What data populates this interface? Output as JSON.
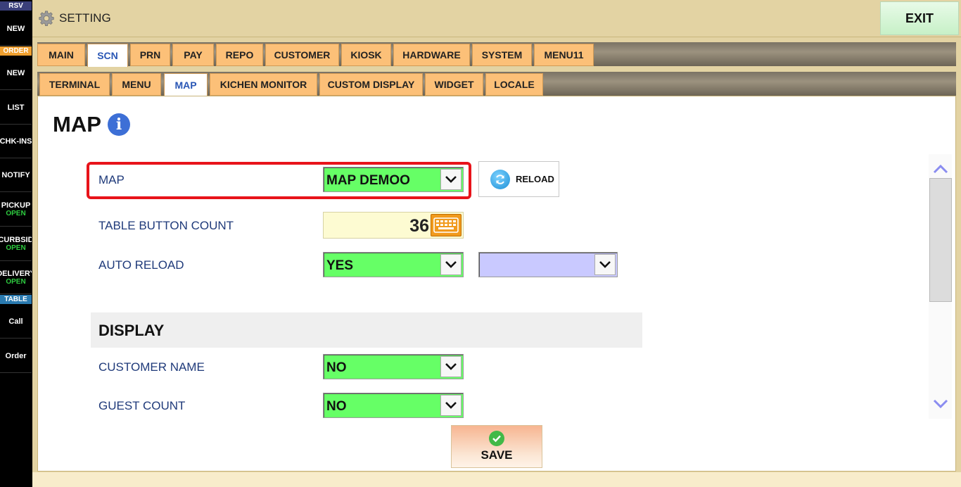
{
  "sidebar": {
    "headers": {
      "rsv": "RSV",
      "order": "ORDER",
      "table": "TABLE"
    },
    "items": [
      {
        "label": "NEW",
        "sub": ""
      },
      {
        "label": "NEW",
        "sub": ""
      },
      {
        "label": "LIST",
        "sub": ""
      },
      {
        "label": "CHK-INS",
        "sub": ""
      },
      {
        "label": "NOTIFY",
        "sub": ""
      },
      {
        "label": "PICKUP",
        "sub": "OPEN"
      },
      {
        "label": "CURBSID",
        "sub": "OPEN"
      },
      {
        "label": "DELIVERY",
        "sub": "OPEN"
      },
      {
        "label": "Call",
        "sub": ""
      },
      {
        "label": "Order",
        "sub": ""
      }
    ],
    "colors": {
      "rsv_bg": "#3a3f7a",
      "order_bg": "#f0a030",
      "table_bg": "#2a7ab0"
    }
  },
  "topbar": {
    "title": "SETTING",
    "exit_label": "EXIT",
    "icon": "gear-icon"
  },
  "tabs_main": {
    "active": "SCN",
    "items": [
      "MAIN",
      "SCN",
      "PRN",
      "PAY",
      "REPO",
      "CUSTOMER",
      "KIOSK",
      "HARDWARE",
      "SYSTEM",
      "MENU11"
    ]
  },
  "tabs_sub": {
    "active": "MAP",
    "items": [
      "TERMINAL",
      "MENU",
      "MAP",
      "KICHEN MONITOR",
      "CUSTOM DISPLAY",
      "WIDGET",
      "LOCALE"
    ]
  },
  "page": {
    "title": "MAP",
    "info_glyph": "i",
    "map": {
      "label": "MAP",
      "value": "MAP DEMOO"
    },
    "reload_label": "RELOAD",
    "table_button_count": {
      "label": "TABLE BUTTON COUNT",
      "value": "36"
    },
    "auto_reload": {
      "label": "AUTO RELOAD",
      "value": "YES",
      "secondary_value": ""
    },
    "display_section": "DISPLAY",
    "customer_name": {
      "label": "CUSTOMER NAME",
      "value": "NO"
    },
    "guest_count": {
      "label": "GUEST COUNT",
      "value": "NO"
    },
    "save_label": "SAVE",
    "colors": {
      "select_green": "#66ff66",
      "select_lavender": "#c9c9ff",
      "highlight_red": "#e8131a",
      "label_blue": "#1f3a7a"
    }
  }
}
